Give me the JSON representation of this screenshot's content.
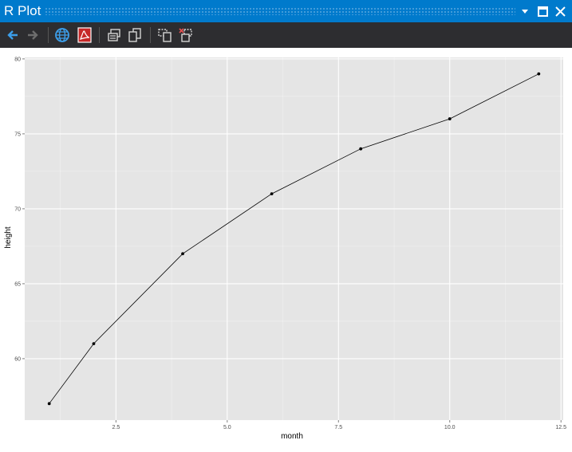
{
  "window": {
    "title": "R Plot",
    "dropdown_icon": "chevron-down-icon",
    "maximize_icon": "maximize-icon",
    "close_icon": "close-icon"
  },
  "toolbar": {
    "items": [
      {
        "name": "back-button",
        "icon": "arrow-left-icon"
      },
      {
        "name": "forward-button",
        "icon": "arrow-right-icon"
      },
      {
        "name": "export-web-button",
        "icon": "globe-icon"
      },
      {
        "name": "export-pdf-button",
        "icon": "pdf-icon"
      },
      {
        "name": "copy-bitmap-button",
        "icon": "copy-icon"
      },
      {
        "name": "copy-metafile-button",
        "icon": "copy-alt-icon"
      },
      {
        "name": "remove-plot-button",
        "icon": "remove-plot-icon"
      },
      {
        "name": "clear-all-plots-button",
        "icon": "clear-all-icon"
      }
    ]
  },
  "chart_data": {
    "type": "line",
    "xlabel": "month",
    "ylabel": "height",
    "x": [
      1,
      2,
      4,
      6,
      8,
      10,
      12
    ],
    "series": [
      {
        "values": [
          57,
          61,
          67,
          71,
          74,
          76,
          79
        ]
      }
    ],
    "xlim": [
      0.45,
      12.55
    ],
    "ylim": [
      55.9,
      80.1
    ],
    "x_ticks": [
      2.5,
      5.0,
      7.5,
      10.0,
      12.5
    ],
    "x_tick_labels": [
      "2.5",
      "5.0",
      "7.5",
      "10.0",
      "12.5"
    ],
    "y_ticks": [
      60,
      65,
      70,
      75,
      80
    ],
    "y_tick_labels": [
      "60",
      "65",
      "70",
      "75",
      "80"
    ],
    "grid": true,
    "panel_background": "#e5e5e5",
    "grid_color": "#ffffff",
    "line_color": "#000000"
  }
}
